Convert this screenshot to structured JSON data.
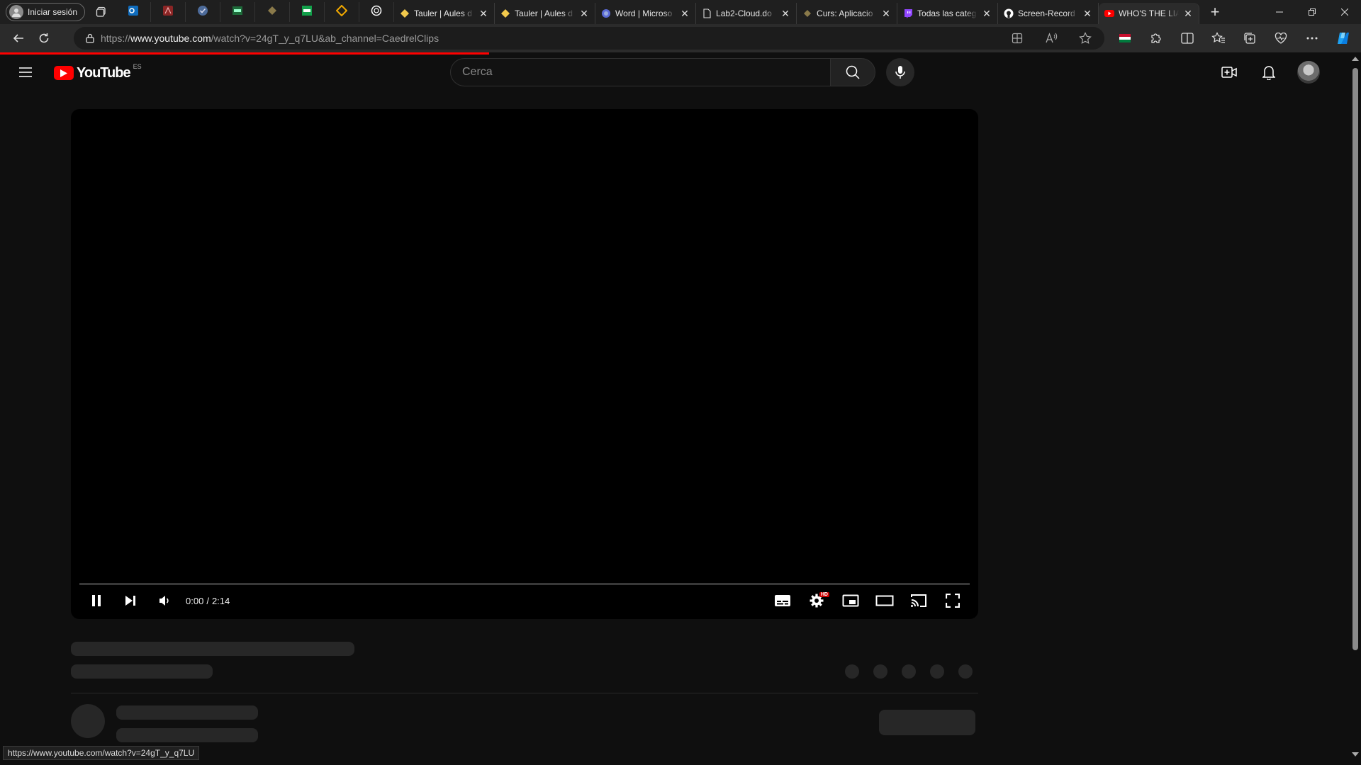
{
  "browser": {
    "profile_label": "Iniciar sesión",
    "pinned_tabs": [
      {
        "icon": "outlook-icon",
        "color": "#0f6cbd"
      },
      {
        "icon": "acrobat-icon",
        "color": "#8b2525"
      },
      {
        "icon": "check-icon",
        "color": "#4d6b9a"
      },
      {
        "icon": "uab-icon",
        "color": "#1e6b3a"
      },
      {
        "icon": "diamond-icon",
        "color": "#8a7a4a"
      },
      {
        "icon": "uab-green-icon",
        "color": "#12a04a"
      },
      {
        "icon": "moodle-icon",
        "color": "#f2a900"
      },
      {
        "icon": "chatgpt-icon",
        "color": "#ffffff"
      }
    ],
    "tabs": [
      {
        "title": "Tauler | Aules d",
        "icon": "moodle-icon",
        "active": false
      },
      {
        "title": "Tauler | Aules d",
        "icon": "moodle-icon",
        "active": false
      },
      {
        "title": "Word | Microso",
        "icon": "copilot-icon",
        "active": false
      },
      {
        "title": "Lab2-Cloud.do",
        "icon": "document-icon",
        "active": false
      },
      {
        "title": "Curs: Aplicacio",
        "icon": "diamond-icon",
        "active": false
      },
      {
        "title": "Todas las categ",
        "icon": "twitch-icon",
        "active": false
      },
      {
        "title": "Screen-Record",
        "icon": "github-icon",
        "active": false
      },
      {
        "title": "WHO'S THE LIA",
        "icon": "youtube-icon",
        "active": true
      }
    ],
    "close_glyph": "✕",
    "new_tab_glyph": "+",
    "url_prefix": "https://",
    "url_domain": "www.youtube.com",
    "url_path": "/watch?v=24gT_y_q7LU&ab_channel=CaedrelClips",
    "status_url": "https://www.youtube.com/watch?v=24gT_y_q7LU"
  },
  "youtube": {
    "logo_text": "YouTube",
    "region": "ES",
    "search_placeholder": "Cerca",
    "player": {
      "current_time": "0:00",
      "separator": "/",
      "duration": "2:14",
      "progress": 0,
      "settings_badge": "HD"
    }
  },
  "colors": {
    "accent": "#ff0000",
    "background": "#0f0f0f",
    "skeleton": "#272727"
  }
}
